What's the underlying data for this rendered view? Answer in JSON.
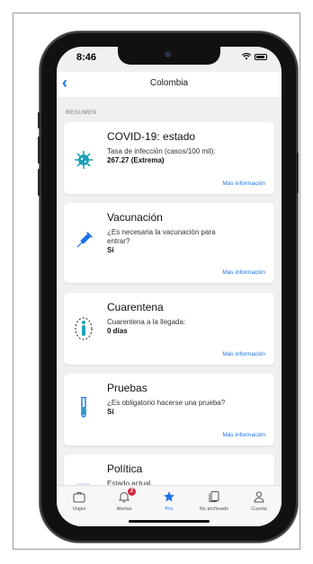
{
  "status": {
    "time": "8:46"
  },
  "nav": {
    "title": "Colombia"
  },
  "section_label": "RESUMEN",
  "cards": [
    {
      "title": "COVID-19: estado",
      "question": "Tasa de infección (casos/100 mil):",
      "answer": "267.27 (Extrema)",
      "link": "Más información",
      "icon": "virus-icon"
    },
    {
      "title": "Vacunación",
      "question": "¿Es necesaria la vacunación para entrar?",
      "answer": "Sí",
      "link": "Más información",
      "icon": "syringe-icon"
    },
    {
      "title": "Cuarentena",
      "question": "Cuarentena a la llegada:",
      "answer": "0 días",
      "link": "Más información",
      "icon": "quarantine-person-icon"
    },
    {
      "title": "Pruebas",
      "question": "¿Es obligatorio hacerse una prueba?",
      "answer": "Sí",
      "link": "Más información",
      "icon": "test-tube-icon"
    },
    {
      "title": "Política",
      "question": "Estado actual",
      "answer": "",
      "link": "",
      "icon": "policy-icon"
    }
  ],
  "tabs": [
    {
      "label": "Viajes",
      "icon": "suitcase-icon"
    },
    {
      "label": "Alertas",
      "icon": "bell-icon",
      "badge": "2"
    },
    {
      "label": "Pro",
      "icon": "star-icon"
    },
    {
      "label": "No archivado",
      "icon": "document-icon"
    },
    {
      "label": "Cuenta",
      "icon": "person-icon"
    }
  ],
  "colors": {
    "accent": "#1a73e8",
    "virus": "#1ea2b8",
    "badge": "#d7263d"
  }
}
